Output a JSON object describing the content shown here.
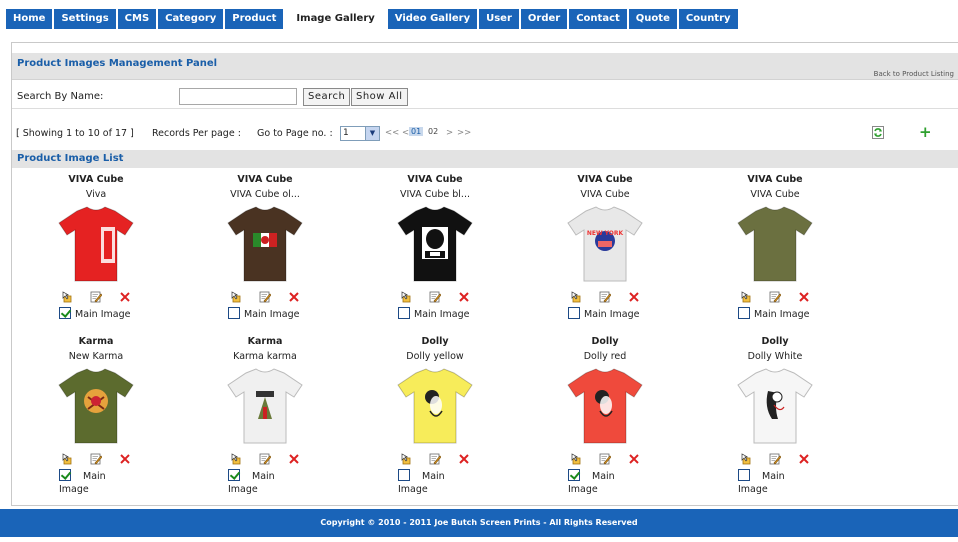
{
  "nav": {
    "tabs": [
      {
        "label": "Home",
        "active": false
      },
      {
        "label": "Settings",
        "active": false
      },
      {
        "label": "CMS",
        "active": false
      },
      {
        "label": "Category",
        "active": false
      },
      {
        "label": "Product",
        "active": false
      },
      {
        "label": "Image Gallery",
        "active": true
      },
      {
        "label": "Video Gallery",
        "active": false
      },
      {
        "label": "User",
        "active": false
      },
      {
        "label": "Order",
        "active": false
      },
      {
        "label": "Contact",
        "active": false
      },
      {
        "label": "Quote",
        "active": false
      },
      {
        "label": "Country",
        "active": false
      }
    ]
  },
  "panel": {
    "title": "Product Images Management Panel",
    "back_link": "Back to Product Listing"
  },
  "search": {
    "label": "Search By Name:",
    "value": "",
    "search_button": "Search",
    "show_all_button": "Show All"
  },
  "pager": {
    "showing": "[ Showing 1 to 10 of 17 ]",
    "records_per_page": "Records Per page :",
    "goto_label": "Go to Page no. :",
    "selected_page": "1",
    "first": "<<",
    "prev": "<",
    "pages": [
      "01",
      "02"
    ],
    "current_page": "01",
    "next": ">",
    "last": ">>"
  },
  "list": {
    "title": "Product Image List",
    "main_image_label": "Main Image",
    "items": [
      {
        "name": "VIVA Cube",
        "caption": "Viva",
        "main": true,
        "shirt_color": "#e52222",
        "print": "viva"
      },
      {
        "name": "VIVA Cube",
        "caption": "VIVA Cube ol...",
        "main": false,
        "shirt_color": "#4a3322",
        "print": "flag"
      },
      {
        "name": "VIVA Cube",
        "caption": "VIVA Cube bl...",
        "main": false,
        "shirt_color": "#111111",
        "print": "face"
      },
      {
        "name": "VIVA Cube",
        "caption": "VIVA Cube",
        "main": false,
        "shirt_color": "#e8e8e8",
        "print": "ny"
      },
      {
        "name": "VIVA Cube",
        "caption": "VIVA Cube",
        "main": false,
        "shirt_color": "#6b7040",
        "print": "none"
      },
      {
        "name": "Karma",
        "caption": "New Karma",
        "main": true,
        "shirt_color": "#5c6b2e",
        "print": "karma"
      },
      {
        "name": "Karma",
        "caption": "Karma karma",
        "main": true,
        "shirt_color": "#f0f0f0",
        "print": "karma2"
      },
      {
        "name": "Dolly",
        "caption": "Dolly yellow",
        "main": false,
        "shirt_color": "#f7ec5a",
        "print": "girl"
      },
      {
        "name": "Dolly",
        "caption": "Dolly red",
        "main": true,
        "shirt_color": "#ef4a3c",
        "print": "girl"
      },
      {
        "name": "Dolly",
        "caption": "Dolly White",
        "main": false,
        "shirt_color": "#f6f6f6",
        "print": "girl2"
      }
    ]
  },
  "footer": {
    "text": "Copyright © 2010 - 2011 Joe Butch Screen Prints - All Rights Reserved"
  },
  "colors": {
    "nav_bg": "#1a64b8",
    "title_blue": "#1a5ea8",
    "header_gray": "#e3e3e3",
    "delete_red": "#d22",
    "edit_icon": "#555",
    "plus_green": "#2ea02e"
  },
  "icons": {
    "move": "move-icon",
    "edit": "edit-icon",
    "delete": "delete-icon",
    "refresh": "refresh-icon",
    "add": "plus-icon"
  }
}
